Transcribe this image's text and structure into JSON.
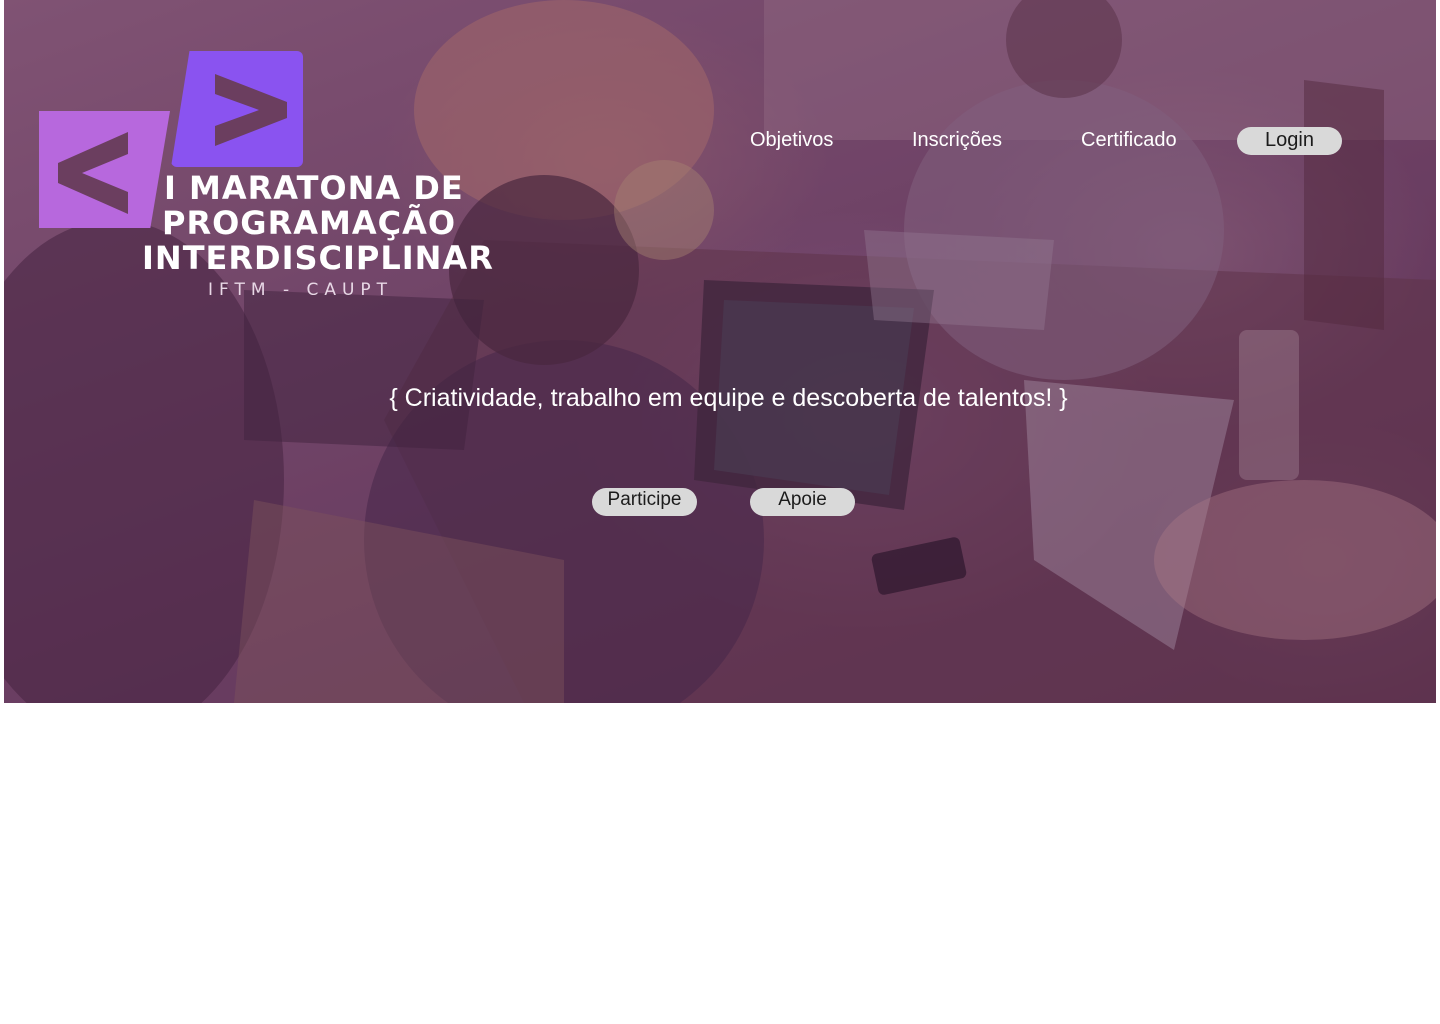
{
  "brand": {
    "logo_line1": "I MARATONA DE",
    "logo_line2": "PROGRAMAÇÃO",
    "logo_line3": "INTERDISCIPLINAR",
    "logo_subtitle": "IFTM - CAUPT",
    "logo_left_glyph": "<",
    "logo_right_glyph": ">",
    "colors": {
      "left_block": "#b768dd",
      "right_block": "#8a53f0"
    }
  },
  "nav": {
    "items": [
      {
        "label": "Objetivos"
      },
      {
        "label": "Inscrições"
      },
      {
        "label": "Certificado"
      }
    ],
    "login_label": "Login"
  },
  "hero": {
    "tagline": "{ Criatividade, trabalho em equipe e descoberta de talentos! }",
    "cta_primary": "Participe",
    "cta_secondary": "Apoie",
    "overlay_color": "#6a2f63"
  }
}
